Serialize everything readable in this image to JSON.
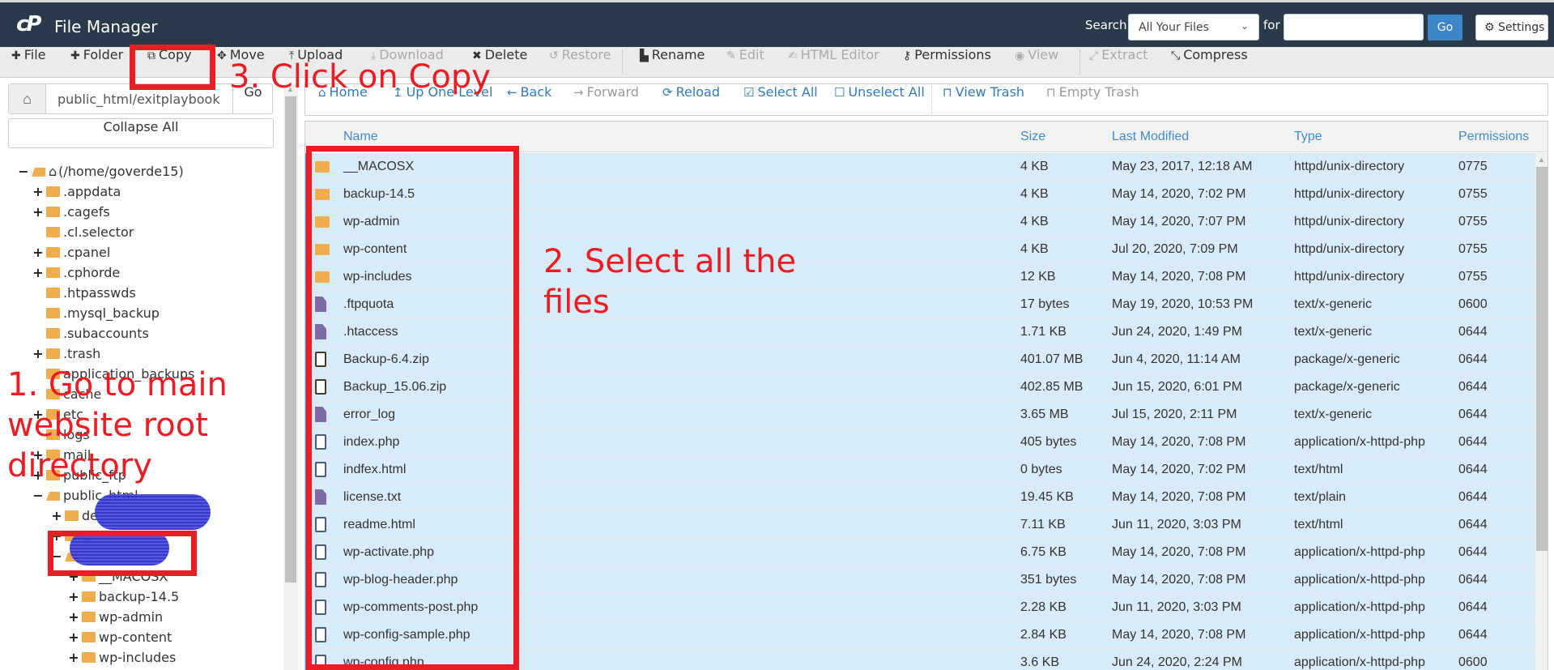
{
  "header": {
    "logo": "cP",
    "title": "File Manager",
    "search_label": "Search",
    "search_scope": "All Your Files",
    "for_label": "for",
    "search_value": "",
    "go_label": "Go",
    "settings_label": "Settings"
  },
  "toolbar": {
    "items": [
      {
        "label": "File",
        "icon": "plus-icon",
        "enabled": true
      },
      {
        "label": "Folder",
        "icon": "plus-icon",
        "enabled": true
      },
      {
        "label": "Copy",
        "icon": "copy-icon",
        "enabled": true
      },
      {
        "label": "Move",
        "icon": "move-icon",
        "enabled": true
      },
      {
        "label": "Upload",
        "icon": "upload-icon",
        "enabled": true
      },
      {
        "label": "Download",
        "icon": "download-icon",
        "enabled": false
      },
      {
        "label": "Delete",
        "icon": "times-icon",
        "enabled": true
      },
      {
        "label": "Restore",
        "icon": "undo-icon",
        "enabled": false
      },
      {
        "label": "Rename",
        "icon": "file-icon",
        "enabled": true
      },
      {
        "label": "Edit",
        "icon": "pencil-icon",
        "enabled": false
      },
      {
        "label": "HTML Editor",
        "icon": "edit-icon",
        "enabled": false
      },
      {
        "label": "Permissions",
        "icon": "key-icon",
        "enabled": true
      },
      {
        "label": "View",
        "icon": "eye-icon",
        "enabled": false
      },
      {
        "label": "Extract",
        "icon": "expand-icon",
        "enabled": false
      },
      {
        "label": "Compress",
        "icon": "compress-icon",
        "enabled": true
      }
    ]
  },
  "sidebar": {
    "path_value": "public_html/exitplaybook",
    "path_go_label": "Go",
    "collapse_all_label": "Collapse All",
    "tree": [
      {
        "label": "(/home/goverde15)",
        "depth": 0,
        "toggle": "−",
        "open": true,
        "home": true
      },
      {
        "label": ".appdata",
        "depth": 1,
        "toggle": "+"
      },
      {
        "label": ".cagefs",
        "depth": 1,
        "toggle": "+"
      },
      {
        "label": ".cl.selector",
        "depth": 1,
        "toggle": ""
      },
      {
        "label": ".cpanel",
        "depth": 1,
        "toggle": "+"
      },
      {
        "label": ".cphorde",
        "depth": 1,
        "toggle": "+"
      },
      {
        "label": ".htpasswds",
        "depth": 1,
        "toggle": ""
      },
      {
        "label": ".mysql_backup",
        "depth": 1,
        "toggle": ""
      },
      {
        "label": ".subaccounts",
        "depth": 1,
        "toggle": ""
      },
      {
        "label": ".trash",
        "depth": 1,
        "toggle": "+"
      },
      {
        "label": "application_backups",
        "depth": 1,
        "toggle": ""
      },
      {
        "label": "cache",
        "depth": 1,
        "toggle": ""
      },
      {
        "label": "etc",
        "depth": 1,
        "toggle": "+"
      },
      {
        "label": "logs",
        "depth": 1,
        "toggle": ""
      },
      {
        "label": "mail",
        "depth": 1,
        "toggle": "+"
      },
      {
        "label": "public_ftp",
        "depth": 1,
        "toggle": "+"
      },
      {
        "label": "public_html",
        "depth": 1,
        "toggle": "−",
        "open": true
      },
      {
        "label": "de",
        "depth": 2,
        "toggle": "+"
      },
      {
        "label": "d",
        "depth": 2,
        "toggle": "+"
      },
      {
        "label": "",
        "depth": 2,
        "toggle": "−",
        "open": true
      },
      {
        "label": "__MACOSX",
        "depth": 3,
        "toggle": "+"
      },
      {
        "label": "backup-14.5",
        "depth": 3,
        "toggle": "+"
      },
      {
        "label": "wp-admin",
        "depth": 3,
        "toggle": "+"
      },
      {
        "label": "wp-content",
        "depth": 3,
        "toggle": "+"
      },
      {
        "label": "wp-includes",
        "depth": 3,
        "toggle": "+"
      }
    ]
  },
  "nav": {
    "items": [
      {
        "label": "Home",
        "icon": "home-icon",
        "enabled": true
      },
      {
        "label": "Up One Level",
        "icon": "level-up-icon",
        "enabled": true
      },
      {
        "label": "Back",
        "icon": "arrow-left-icon",
        "enabled": true
      },
      {
        "label": "Forward",
        "icon": "arrow-right-icon",
        "enabled": false
      },
      {
        "label": "Reload",
        "icon": "refresh-icon",
        "enabled": true
      },
      {
        "label": "Select All",
        "icon": "checkbox-checked-icon",
        "enabled": true
      },
      {
        "label": "Unselect All",
        "icon": "checkbox-empty-icon",
        "enabled": true
      },
      {
        "label": "View Trash",
        "icon": "trash-icon",
        "enabled": true
      },
      {
        "label": "Empty Trash",
        "icon": "trash-icon",
        "enabled": false
      }
    ]
  },
  "listing": {
    "columns": [
      "Name",
      "Size",
      "Last Modified",
      "Type",
      "Permissions"
    ],
    "rows": [
      {
        "name": "__MACOSX",
        "size": "4 KB",
        "modified": "May 23, 2017, 12:18 AM",
        "type": "httpd/unix-directory",
        "perms": "0775",
        "icon": "folder"
      },
      {
        "name": "backup-14.5",
        "size": "4 KB",
        "modified": "May 14, 2020, 7:02 PM",
        "type": "httpd/unix-directory",
        "perms": "0755",
        "icon": "folder"
      },
      {
        "name": "wp-admin",
        "size": "4 KB",
        "modified": "May 14, 2020, 7:07 PM",
        "type": "httpd/unix-directory",
        "perms": "0755",
        "icon": "folder"
      },
      {
        "name": "wp-content",
        "size": "4 KB",
        "modified": "Jul 20, 2020, 7:09 PM",
        "type": "httpd/unix-directory",
        "perms": "0755",
        "icon": "folder"
      },
      {
        "name": "wp-includes",
        "size": "12 KB",
        "modified": "May 14, 2020, 7:08 PM",
        "type": "httpd/unix-directory",
        "perms": "0755",
        "icon": "folder"
      },
      {
        "name": ".ftpquota",
        "size": "17 bytes",
        "modified": "May 19, 2020, 10:53 PM",
        "type": "text/x-generic",
        "perms": "0600",
        "icon": "text"
      },
      {
        "name": ".htaccess",
        "size": "1.71 KB",
        "modified": "Jun 24, 2020, 1:49 PM",
        "type": "text/x-generic",
        "perms": "0644",
        "icon": "text"
      },
      {
        "name": "Backup-6.4.zip",
        "size": "401.07 MB",
        "modified": "Jun 4, 2020, 11:14 AM",
        "type": "package/x-generic",
        "perms": "0644",
        "icon": "zip"
      },
      {
        "name": "Backup_15.06.zip",
        "size": "402.85 MB",
        "modified": "Jun 15, 2020, 6:01 PM",
        "type": "package/x-generic",
        "perms": "0644",
        "icon": "zip"
      },
      {
        "name": "error_log",
        "size": "3.65 MB",
        "modified": "Jul 15, 2020, 2:11 PM",
        "type": "text/x-generic",
        "perms": "0644",
        "icon": "text"
      },
      {
        "name": "index.php",
        "size": "405 bytes",
        "modified": "May 14, 2020, 7:08 PM",
        "type": "application/x-httpd-php",
        "perms": "0644",
        "icon": "code"
      },
      {
        "name": "indfex.html",
        "size": "0 bytes",
        "modified": "May 14, 2020, 7:02 PM",
        "type": "text/html",
        "perms": "0644",
        "icon": "code"
      },
      {
        "name": "license.txt",
        "size": "19.45 KB",
        "modified": "May 14, 2020, 7:08 PM",
        "type": "text/plain",
        "perms": "0644",
        "icon": "text"
      },
      {
        "name": "readme.html",
        "size": "7.11 KB",
        "modified": "Jun 11, 2020, 3:03 PM",
        "type": "text/html",
        "perms": "0644",
        "icon": "code"
      },
      {
        "name": "wp-activate.php",
        "size": "6.75 KB",
        "modified": "May 14, 2020, 7:08 PM",
        "type": "application/x-httpd-php",
        "perms": "0644",
        "icon": "code"
      },
      {
        "name": "wp-blog-header.php",
        "size": "351 bytes",
        "modified": "May 14, 2020, 7:08 PM",
        "type": "application/x-httpd-php",
        "perms": "0644",
        "icon": "code"
      },
      {
        "name": "wp-comments-post.php",
        "size": "2.28 KB",
        "modified": "Jun 11, 2020, 3:03 PM",
        "type": "application/x-httpd-php",
        "perms": "0644",
        "icon": "code"
      },
      {
        "name": "wp-config-sample.php",
        "size": "2.84 KB",
        "modified": "May 14, 2020, 7:08 PM",
        "type": "application/x-httpd-php",
        "perms": "0644",
        "icon": "code"
      },
      {
        "name": "wp-config.php",
        "size": "3.6 KB",
        "modified": "Jun 24, 2020, 2:24 PM",
        "type": "application/x-httpd-php",
        "perms": "0600",
        "icon": "code"
      }
    ]
  },
  "annotations": {
    "step1": "1. Go to main website root directory",
    "step1_lines": [
      "1. Go to main",
      "website root",
      "directory"
    ],
    "step2_lines": [
      "2. Select all the",
      "files"
    ],
    "step3": "3. Click on Copy",
    "color": "#ec1c24"
  },
  "colors": {
    "header_bg": "#293a4a",
    "accent": "#3b86c8",
    "link": "#337ab7",
    "selected_row": "#d7ebf9",
    "folder": "#f0ad4e"
  }
}
